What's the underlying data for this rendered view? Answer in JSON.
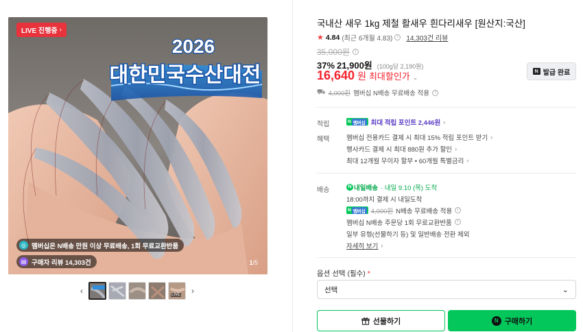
{
  "gallery": {
    "live_badge": "LIVE 진행중",
    "banner_title": "2026",
    "banner_subtitle": "대한민국수산대전",
    "promo_membership": "멤버십은 N배송 만원 이상 무료배송, 1회 무료교환반품",
    "promo_reviews": "구매자 리뷰 14,303건",
    "counter_current": "1",
    "counter_total": "/5",
    "thumb_live": "LIVE",
    "prev_arrow": "‹",
    "next_arrow": "›"
  },
  "product": {
    "title": "국내산 새우 1kg 제철 활새우 흰다리새우 [원산지:국산]",
    "rating": "4.84",
    "rating_recent": "(최근 6개월 4.83)",
    "review_count": "14,303건 리뷰",
    "original_price": "35,000원",
    "discount_pct": "37%",
    "sale_price": "21,900원",
    "unit_price": "(100g당 2,190원)",
    "final_price": "16,640",
    "final_won": "원",
    "final_label": "최대할인가",
    "coupon_button": "발급 완료",
    "shipping_old": "4,000원",
    "shipping_text": "멤버십 N배송 무료배송 적용"
  },
  "points": {
    "label": "적립",
    "badge": "멤버십",
    "text": "최대 적립 포인트 2,446원"
  },
  "benefits": {
    "label": "혜택",
    "lines": [
      "멤버십 전용카드 결제 시 최대 15% 적립 포인트 받기",
      "행사카드 결제 시 최대 880원 추가 할인",
      "최대 12개월 무이자 할부 • 60개월 특별금리"
    ]
  },
  "delivery": {
    "label": "배송",
    "service": "내일배송",
    "arrival": "· 내일 9.10 (목) 도착",
    "cutoff": "18:00까지 결제 시 내일도착",
    "badge": "멤버십",
    "ship_old": "4,000원",
    "ship_text": "N배송 무료배송 적용",
    "exchange": "멤버십 N배송 주문당 1회 무료교환반품",
    "exclude": "일부 유형(선물하기 등) 및 일반배송 전환 제외",
    "more": "자세히 보기"
  },
  "options": {
    "label": "옵션 선택 (필수)",
    "required_mark": "*",
    "select_value": "선택"
  },
  "actions": {
    "gift": "선물하기",
    "buy": "구매하기"
  },
  "colors": {
    "naver_green": "#03c75a",
    "sale_red": "#f5222d",
    "live_red": "#e8323c",
    "point_purple": "#5b3cc4"
  }
}
